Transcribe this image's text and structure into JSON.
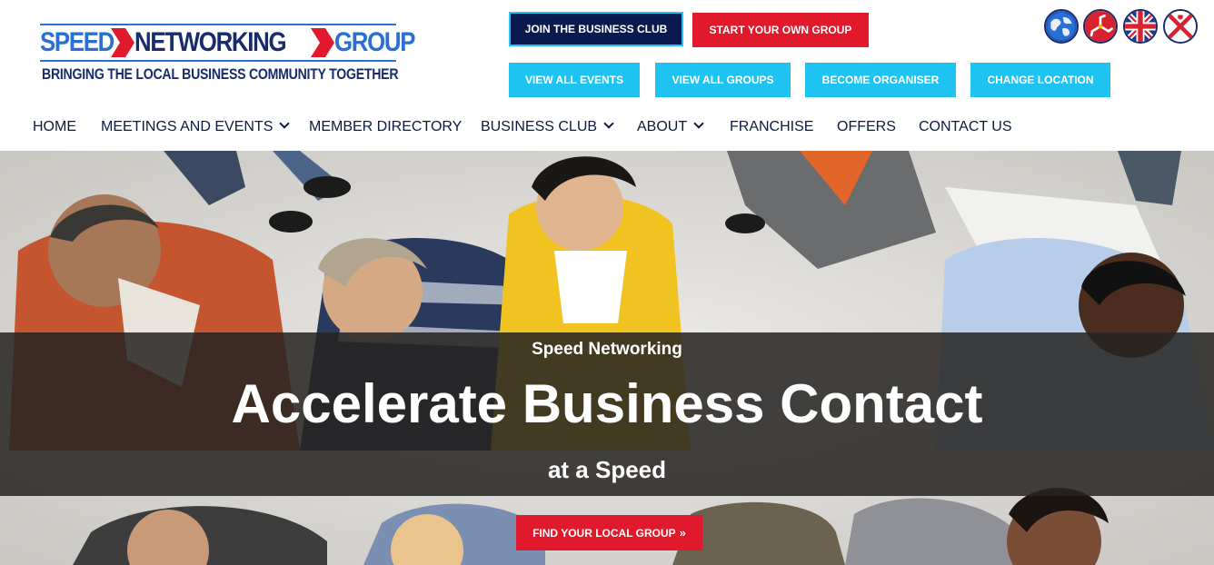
{
  "logo": {
    "word1": "SPEED",
    "word2": "NETWORKING",
    "word3": "GROUP",
    "tagline": "BRINGING THE LOCAL BUSINESS COMMUNITY TOGETHER"
  },
  "top_buttons": {
    "join_business_club": "JOIN THE BUSINESS CLUB",
    "start_own_group": "START YOUR OWN GROUP",
    "view_all_events": "VIEW ALL EVENTS",
    "view_all_groups": "VIEW ALL GROUPS",
    "become_organiser": "BECOME ORGANISER",
    "change_location": "CHANGE LOCATION"
  },
  "locations": [
    "globe-icon",
    "isle-of-man-flag-icon",
    "uk-flag-icon",
    "jersey-flag-icon"
  ],
  "nav": {
    "home": "HOME",
    "meetings": "MEETINGS AND EVENTS",
    "member_directory": "MEMBER DIRECTORY",
    "business_club": "BUSINESS CLUB",
    "about": "ABOUT",
    "franchise": "FRANCHISE",
    "offers": "OFFERS",
    "contact": "CONTACT US"
  },
  "hero": {
    "subtitle": "Speed Networking",
    "title": "Accelerate Business Contact",
    "tagline": "at a Speed",
    "cta_label": "FIND YOUR LOCAL GROUP",
    "cta_icon": "double-chevron-right-icon"
  },
  "colors": {
    "navy": "#0a1a4e",
    "red": "#e1192c",
    "cyan": "#1fc3f2",
    "brand_blue": "#2b6fd1",
    "nav_text": "#0d1a40"
  }
}
